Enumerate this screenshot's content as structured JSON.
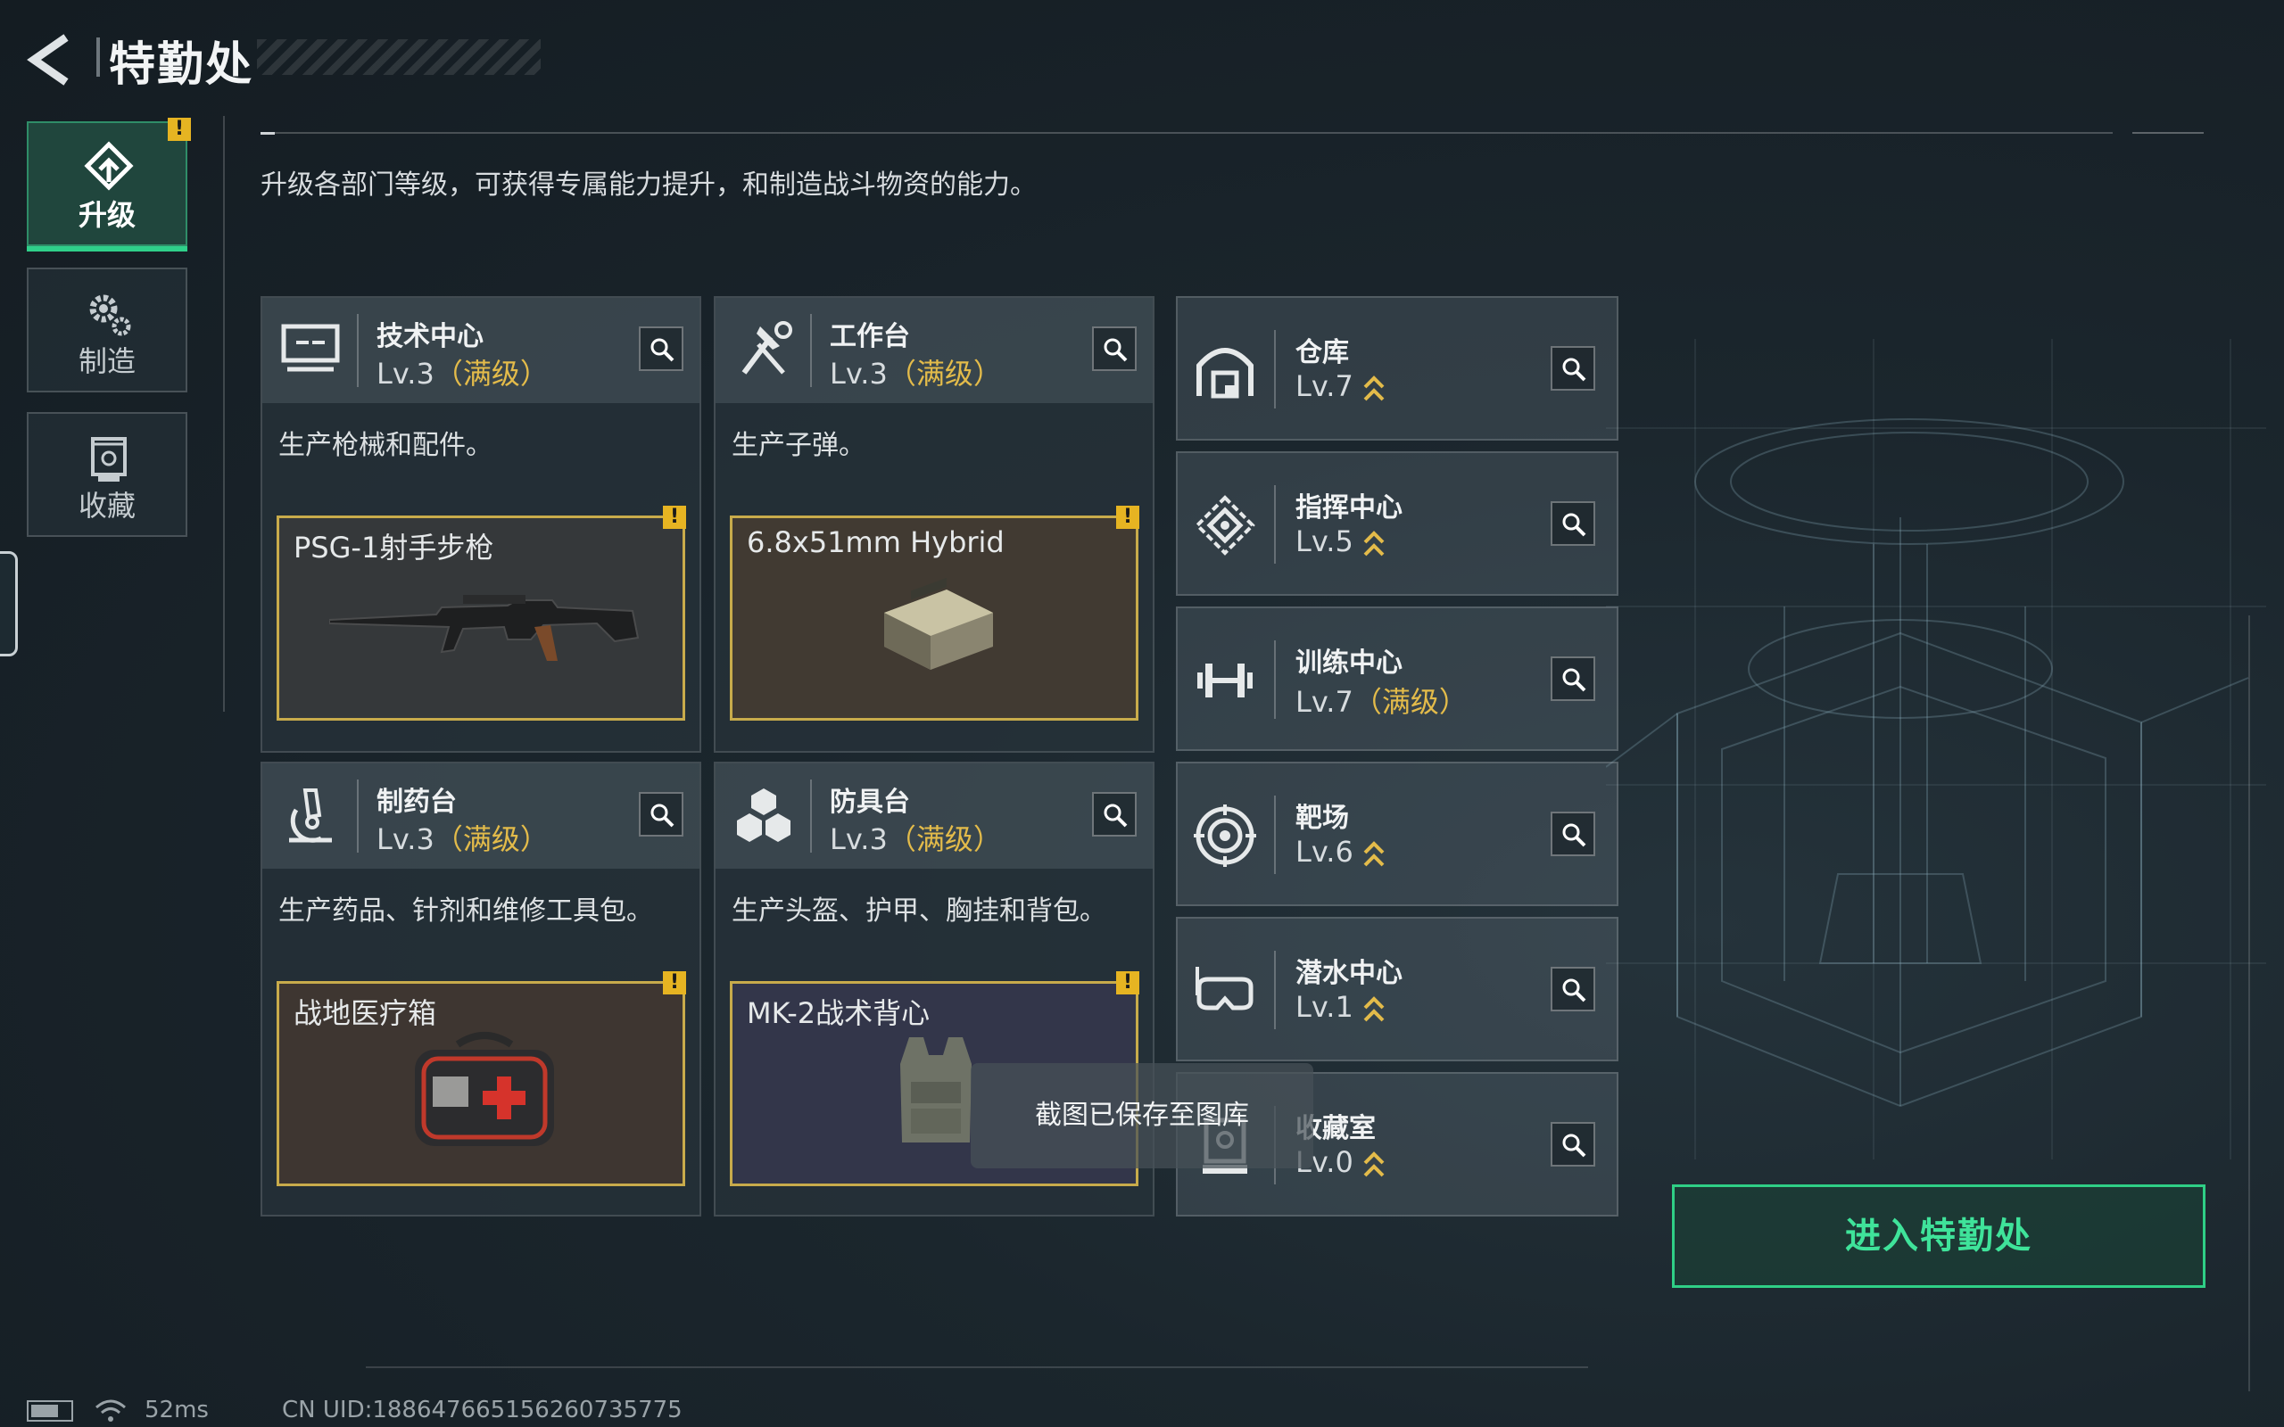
{
  "header": {
    "title": "特勤处"
  },
  "description": "升级各部门等级，可获得专属能力提升，和制造战斗物资的能力。",
  "nav": [
    {
      "label": "升级",
      "active": true,
      "warning": "!"
    },
    {
      "label": "制造"
    },
    {
      "label": "收藏"
    }
  ],
  "cards": [
    {
      "name": "技术中心",
      "level": "Lv.3",
      "max": "（满级）",
      "desc": "生产枪械和配件。",
      "item": "PSG-1射手步枪",
      "warning": "!"
    },
    {
      "name": "工作台",
      "level": "Lv.3",
      "max": "（满级）",
      "desc": "生产子弹。",
      "item": "6.8x51mm Hybrid",
      "warning": "!"
    },
    {
      "name": "制药台",
      "level": "Lv.3",
      "max": "（满级）",
      "desc": "生产药品、针剂和维修工具包。",
      "item": "战地医疗箱",
      "warning": "!"
    },
    {
      "name": "防具台",
      "level": "Lv.3",
      "max": "（满级）",
      "desc": "生产头盔、护甲、胸挂和背包。",
      "item": "MK-2战术背心",
      "warning": "!"
    }
  ],
  "small_cards": [
    {
      "name": "仓库",
      "level": "Lv.7"
    },
    {
      "name": "指挥中心",
      "level": "Lv.5"
    },
    {
      "name": "训练中心",
      "level": "Lv.7",
      "max": "（满级）"
    },
    {
      "name": "靶场",
      "level": "Lv.6"
    },
    {
      "name": "潜水中心",
      "level": "Lv.1"
    },
    {
      "name": "收藏室",
      "level": "Lv.0"
    }
  ],
  "enter_button": "进入特勤处",
  "toast": "截图已保存至图库",
  "footer": {
    "ping": "52ms",
    "uid": "CN UID:1886476651562607357​75"
  },
  "colors": {
    "accent_green": "#2fcf86",
    "max_gold": "#e3bb4a",
    "warning": "#e6b422"
  }
}
